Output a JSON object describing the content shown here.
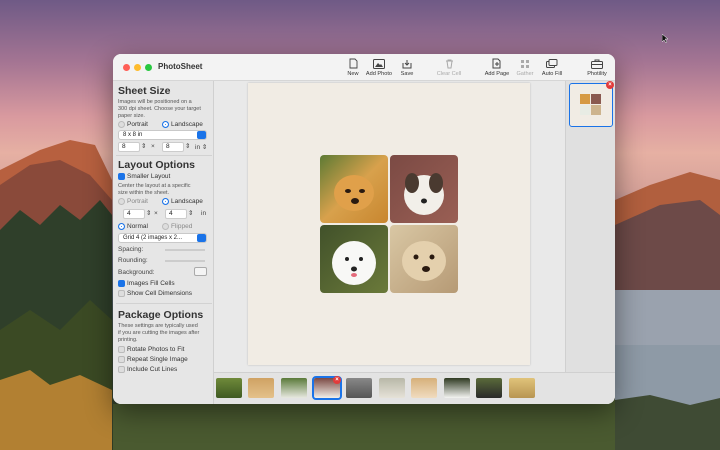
{
  "app": {
    "title": "PhotoSheet"
  },
  "toolbar": {
    "new": "New",
    "add_photo": "Add Photo",
    "save": "Save",
    "clear_cell": "Clear Cell",
    "add_page": "Add Page",
    "gather": "Gather",
    "auto_fill": "Auto Fill",
    "photility": "Photility"
  },
  "sheet_size": {
    "title": "Sheet Size",
    "desc": [
      "Images will be positioned on a",
      "300 dpi sheet. Choose your target",
      "paper size."
    ],
    "portrait": "Portrait",
    "landscape": "Landscape",
    "selected_size": "8 x 8 in",
    "width": "8",
    "height": "8",
    "times": "×",
    "unit": "in"
  },
  "layout_options": {
    "title": "Layout Options",
    "smaller_layout": "Smaller Layout",
    "desc": [
      "Center the layout at a specific",
      "size within the sheet."
    ],
    "portrait": "Portrait",
    "landscape": "Landscape",
    "width": "4",
    "height": "4",
    "times": "×",
    "unit": "in",
    "normal": "Normal",
    "flipped": "Flipped",
    "grid": "Grid 4 (2 images x 2...",
    "spacing": "Spacing:",
    "rounding": "Rounding:",
    "background": "Background:",
    "images_fill_cells": "Images Fill Cells",
    "show_cell_dimensions": "Show Cell Dimensions"
  },
  "package_options": {
    "title": "Package Options",
    "desc": [
      "These settings are typically  used",
      "if you are cutting the images after",
      "printing."
    ],
    "rotate": "Rotate Photos to Fit",
    "repeat": "Repeat Single Image",
    "cut_lines": "Include Cut Lines"
  },
  "colors": {
    "accent": "#1a73e8",
    "close": "#ff5f57",
    "minimize": "#febc2e",
    "zoom": "#28c840",
    "badge": "#e23b3b"
  }
}
